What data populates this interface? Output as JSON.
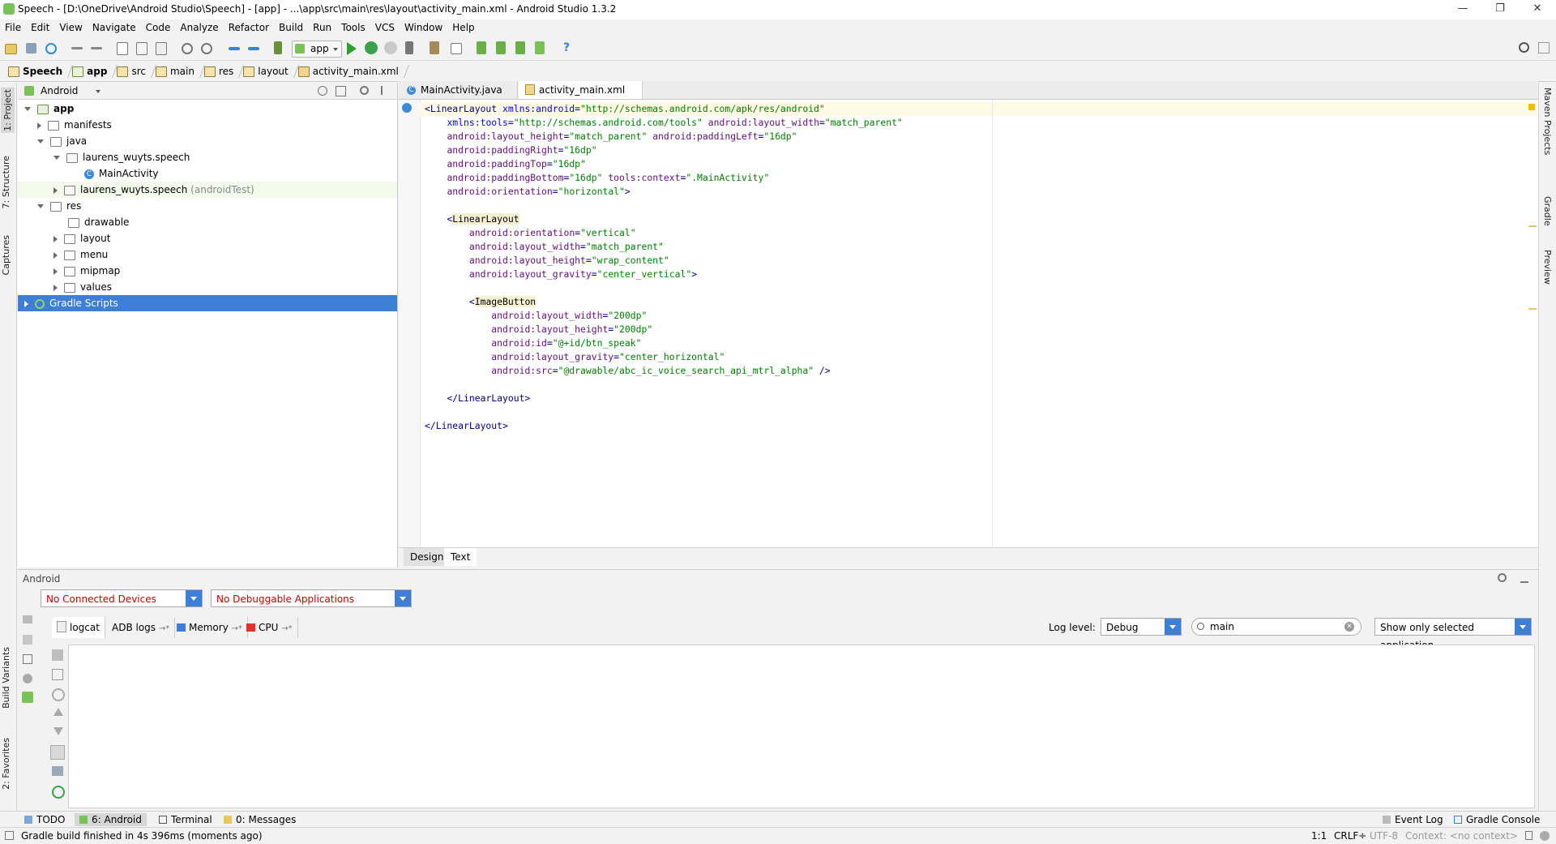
{
  "window": {
    "title": "Speech - [D:\\OneDrive\\Android Studio\\Speech] - [app] - ...\\app\\src\\main\\res\\layout\\activity_main.xml - Android Studio 1.3.2",
    "min_glyph": "—",
    "max_glyph": "❐",
    "close_glyph": "✕"
  },
  "menu": [
    "File",
    "Edit",
    "View",
    "Navigate",
    "Code",
    "Analyze",
    "Refactor",
    "Build",
    "Run",
    "Tools",
    "VCS",
    "Window",
    "Help"
  ],
  "toolbar": {
    "run_config": "app",
    "help_glyph": "?"
  },
  "breadcrumb": [
    "Speech",
    "app",
    "src",
    "main",
    "res",
    "layout",
    "activity_main.xml"
  ],
  "side_left": {
    "project": "1: Project",
    "structure": "7: Structure",
    "captures": "Captures",
    "build_variants": "Build Variants",
    "favorites": "2: Favorites"
  },
  "side_right": {
    "maven": "Maven Projects",
    "gradle": "Gradle",
    "preview": "Preview"
  },
  "project": {
    "view_selector": "Android",
    "tree": {
      "app": "app",
      "manifests": "manifests",
      "java": "java",
      "pkg": "laurens_wuyts.speech",
      "main_activity": "MainActivity",
      "pkg_test": "laurens_wuyts.speech",
      "pkg_test_suffix": "(androidTest)",
      "res": "res",
      "drawable": "drawable",
      "layout": "layout",
      "menu": "menu",
      "mipmap": "mipmap",
      "values": "values",
      "gradle": "Gradle Scripts"
    }
  },
  "editor": {
    "tabs": [
      "MainActivity.java",
      "activity_main.xml"
    ],
    "code": [
      [
        [
          "tag",
          "<LinearLayout "
        ],
        [
          "anm",
          "xmlns:android"
        ],
        [
          "tag",
          "="
        ],
        [
          "str",
          "\"http://schemas.android.com/apk/res/android\""
        ]
      ],
      [
        [
          "sp",
          "    "
        ],
        [
          "anm",
          "xmlns:tools"
        ],
        [
          "tag",
          "="
        ],
        [
          "str",
          "\"http://schemas.android.com/tools\" "
        ],
        [
          "atr",
          "android:layout_width"
        ],
        [
          "tag",
          "="
        ],
        [
          "str",
          "\"match_parent\""
        ]
      ],
      [
        [
          "sp",
          "    "
        ],
        [
          "atr",
          "android:layout_height"
        ],
        [
          "tag",
          "="
        ],
        [
          "str",
          "\"match_parent\" "
        ],
        [
          "atr",
          "android:paddingLeft"
        ],
        [
          "tag",
          "="
        ],
        [
          "str",
          "\"16dp\""
        ]
      ],
      [
        [
          "sp",
          "    "
        ],
        [
          "atr",
          "android:paddingRight"
        ],
        [
          "tag",
          "="
        ],
        [
          "str",
          "\"16dp\""
        ]
      ],
      [
        [
          "sp",
          "    "
        ],
        [
          "atr",
          "android:paddingTop"
        ],
        [
          "tag",
          "="
        ],
        [
          "str",
          "\"16dp\""
        ]
      ],
      [
        [
          "sp",
          "    "
        ],
        [
          "atr",
          "android:paddingBottom"
        ],
        [
          "tag",
          "="
        ],
        [
          "str",
          "\"16dp\" "
        ],
        [
          "atr",
          "tools:context"
        ],
        [
          "tag",
          "="
        ],
        [
          "str",
          "\".MainActivity\""
        ]
      ],
      [
        [
          "sp",
          "    "
        ],
        [
          "atr",
          "android:orientation"
        ],
        [
          "tag",
          "="
        ],
        [
          "str",
          "\"horizontal\""
        ],
        [
          "tag",
          ">"
        ]
      ],
      [
        [
          "sp",
          ""
        ]
      ],
      [
        [
          "sp",
          "    "
        ],
        [
          "tag",
          "<"
        ],
        [
          "hl",
          "LinearLayout"
        ]
      ],
      [
        [
          "sp",
          "        "
        ],
        [
          "atr",
          "android:orientation"
        ],
        [
          "tag",
          "="
        ],
        [
          "str",
          "\"vertical\""
        ]
      ],
      [
        [
          "sp",
          "        "
        ],
        [
          "atr",
          "android:layout_width"
        ],
        [
          "tag",
          "="
        ],
        [
          "str",
          "\"match_parent\""
        ]
      ],
      [
        [
          "sp",
          "        "
        ],
        [
          "atr",
          "android:layout_height"
        ],
        [
          "tag",
          "="
        ],
        [
          "str",
          "\"wrap_content\""
        ]
      ],
      [
        [
          "sp",
          "        "
        ],
        [
          "atr",
          "android:layout_gravity"
        ],
        [
          "tag",
          "="
        ],
        [
          "str",
          "\"center_vertical\""
        ],
        [
          "tag",
          ">"
        ]
      ],
      [
        [
          "sp",
          ""
        ]
      ],
      [
        [
          "sp",
          "        "
        ],
        [
          "tag",
          "<"
        ],
        [
          "hl",
          "ImageButton"
        ]
      ],
      [
        [
          "sp",
          "            "
        ],
        [
          "atr",
          "android:layout_width"
        ],
        [
          "tag",
          "="
        ],
        [
          "str",
          "\"200dp\""
        ]
      ],
      [
        [
          "sp",
          "            "
        ],
        [
          "atr",
          "android:layout_height"
        ],
        [
          "tag",
          "="
        ],
        [
          "str",
          "\"200dp\""
        ]
      ],
      [
        [
          "sp",
          "            "
        ],
        [
          "atr",
          "android:id"
        ],
        [
          "tag",
          "="
        ],
        [
          "str",
          "\"@+id/btn_speak\""
        ]
      ],
      [
        [
          "sp",
          "            "
        ],
        [
          "atr",
          "android:layout_gravity"
        ],
        [
          "tag",
          "="
        ],
        [
          "str",
          "\"center_horizontal\""
        ]
      ],
      [
        [
          "sp",
          "            "
        ],
        [
          "atr",
          "android:src"
        ],
        [
          "tag",
          "="
        ],
        [
          "str",
          "\"@drawable/abc_ic_voice_search_api_mtrl_alpha\" "
        ],
        [
          "tag",
          "/>"
        ]
      ],
      [
        [
          "sp",
          ""
        ]
      ],
      [
        [
          "sp",
          "    "
        ],
        [
          "tag",
          "</LinearLayout>"
        ]
      ],
      [
        [
          "sp",
          ""
        ]
      ],
      [
        [
          "tag",
          "</LinearLayout>"
        ]
      ]
    ],
    "design_tabs": [
      "Design",
      "Text"
    ]
  },
  "android_panel": {
    "title": "Android",
    "devices": "No Connected Devices",
    "apps": "No Debuggable Applications",
    "tabs": [
      "logcat",
      "ADB logs",
      "Memory",
      "CPU"
    ],
    "log_level_label": "Log level:",
    "log_level": "Debug",
    "search_value": "main",
    "filter": "Show only selected application"
  },
  "bottom_tools": [
    "TODO",
    "6: Android",
    "Terminal",
    "0: Messages",
    "Event Log",
    "Gradle Console"
  ],
  "status": {
    "message": "Gradle build finished in 4s 396ms (moments ago)",
    "position": "1:1",
    "line_sep": "CRLF÷",
    "encoding": "UTF-8",
    "context": "Context: <no context>"
  },
  "colors": {
    "selection": "#3d7fd6",
    "accent": "#3d7fd6",
    "error_text": "#cc0000"
  }
}
